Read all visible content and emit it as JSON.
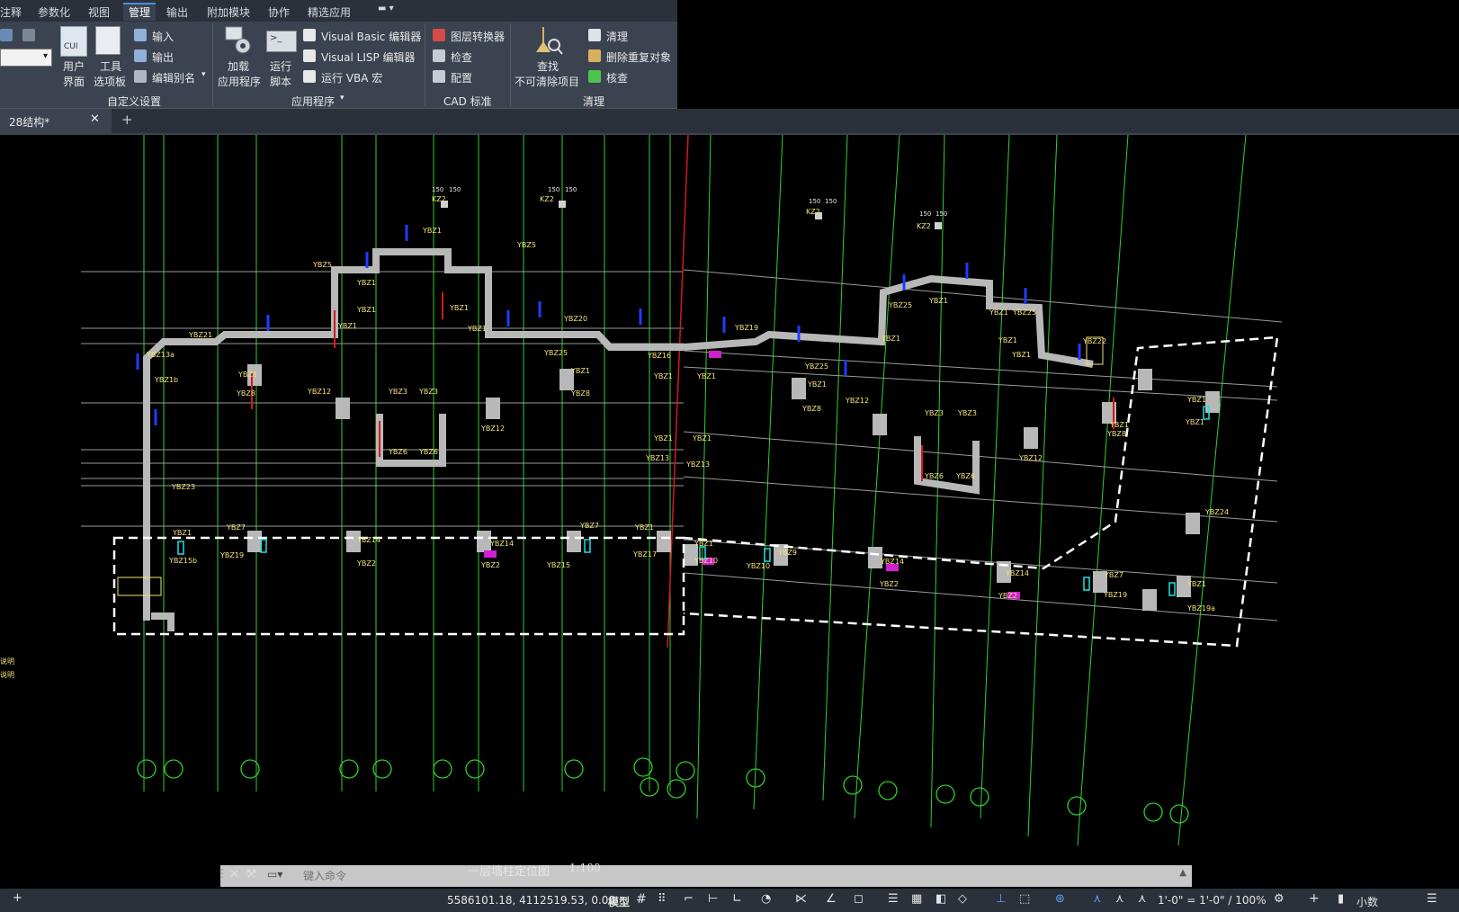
{
  "menu": {
    "items": [
      "注释",
      "参数化",
      "视图",
      "管理",
      "输出",
      "附加模块",
      "协作",
      "精选应用"
    ],
    "active": "管理"
  },
  "ribbon": {
    "customize": {
      "user_interface_line1": "用户",
      "user_interface_line2": "界面",
      "tool_palettes_line1": "工具",
      "tool_palettes_line2": "选项板",
      "import": "输入",
      "export": "输出",
      "edit_aliases": "编辑别名",
      "panel": "自定义设置"
    },
    "applications": {
      "load_line1": "加载",
      "load_line2": "应用程序",
      "run_line1": "运行",
      "run_line2": "脚本",
      "vb_editor": "Visual Basic 编辑器",
      "lisp_editor": "Visual LISP 编辑器",
      "run_vba": "运行 VBA 宏",
      "panel": "应用程序"
    },
    "cad_standards": {
      "layer_translator": "图层转换器",
      "check": "检查",
      "configure": "配置",
      "panel": "CAD 标准"
    },
    "cleanup": {
      "find_line1": "查找",
      "find_line2": "不可清除项目",
      "purge": "清理",
      "overkill": "删除重复对象",
      "audit": "核查",
      "panel": "清理"
    }
  },
  "file_tab": {
    "name": "28结构*"
  },
  "drawing": {
    "labels": [
      "YBZ1",
      "YBZ5",
      "YBZ21",
      "YBZ13a",
      "YBZ1b",
      "YBZ8",
      "YBZ12",
      "YBZ3",
      "YBZ6",
      "YBZ20",
      "YBZ25",
      "YBZ16",
      "YBZ13",
      "YBZ23",
      "YBZ7",
      "YBZ14",
      "YBZ2",
      "YBZ15",
      "YBZ17",
      "YBZ15b",
      "YBZ19",
      "YBZ10",
      "YBZ9",
      "YBZ22",
      "YBZ24",
      "YBZ19a",
      "KZ2"
    ],
    "dimension": "150",
    "notes": [
      "说明",
      "说明"
    ],
    "title": "一层墙柱定位图",
    "scale": "1:100"
  },
  "command": {
    "placeholder": "键入命令"
  },
  "status": {
    "coords": "5586101.18, 4112519.53, 0.00",
    "model": "模型",
    "annotation_scale": "1'-0\" = 1'-0\" / 100%",
    "units": "小数"
  },
  "colors": {
    "grid_green": "#2fd12f",
    "axis_gray": "#9a9a9a",
    "wall_gray": "#b8b8b8",
    "label_yellow": "#f2e27a",
    "dim_blue": "#1f3cff",
    "dim_magenta": "#d01fd0",
    "dim_cyan": "#20e0e0",
    "red_line": "#d21a1a"
  }
}
